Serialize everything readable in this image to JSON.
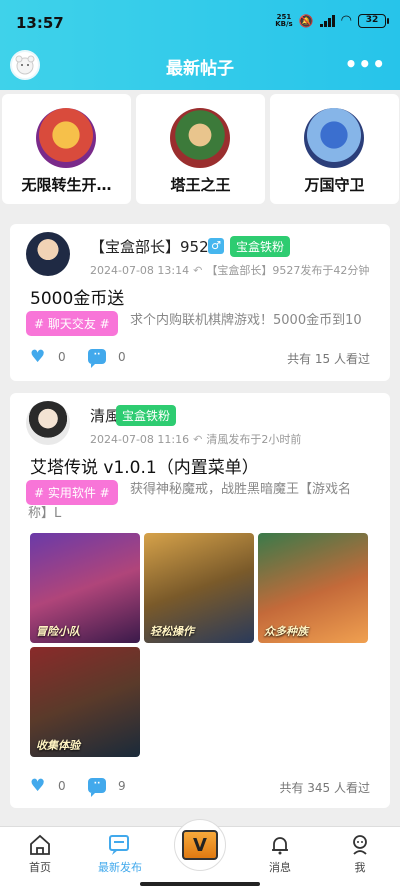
{
  "status": {
    "time": "13:57",
    "netspeed_value": "251",
    "netspeed_unit": "KB/s",
    "battery": "32"
  },
  "header": {
    "title": "最新帖子",
    "more": "•••"
  },
  "games": [
    {
      "name": "无限转生开…"
    },
    {
      "name": "塔王之王"
    },
    {
      "name": "万国守卫"
    }
  ],
  "posts": [
    {
      "username": "【宝盒部长】9527",
      "badge": "宝盒铁粉",
      "gender_symbol": "♂",
      "date": "2024-07-08 13:14",
      "reply_info": "【宝盒部长】9527发布于42分钟",
      "title": "5000金币送",
      "tag": "# 聊天交友 #",
      "excerpt": "求个内购联机棋牌游戏！5000金币到10",
      "likes": "0",
      "comments": "0",
      "views": "共有 15 人看过"
    },
    {
      "username": "清風",
      "badge": "宝盒铁粉",
      "date": "2024-07-08 11:16",
      "reply_info": "清風发布于2小时前",
      "title": "艾塔传说 v1.0.1（内置菜单）",
      "tag": "# 实用软件 #",
      "excerpt_line1": "获得神秘魔戒，战胜黑暗魔王【游戏名",
      "excerpt_line2": "称】L",
      "images": [
        {
          "caption": "冒险小队"
        },
        {
          "caption": "轻松操作"
        },
        {
          "caption": "众多种族"
        },
        {
          "caption": "收集体验"
        }
      ],
      "likes": "0",
      "comments": "9",
      "views": "共有 345 人看过"
    }
  ],
  "tabbar": {
    "home": "首页",
    "latest": "最新发布",
    "messages": "消息",
    "me": "我",
    "center": "V"
  },
  "colors": {
    "accent": "#27c4ea",
    "badge": "#2ecc71",
    "tag": "#f875d8",
    "icon_blue": "#42a9ec"
  }
}
